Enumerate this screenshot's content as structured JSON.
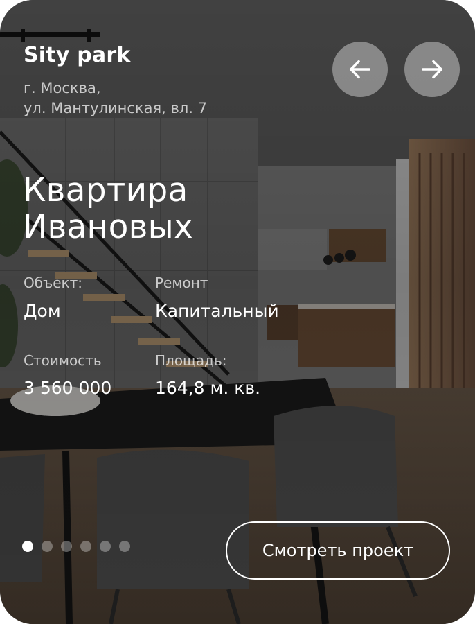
{
  "project": {
    "brand": "Sity park",
    "address_line1": "г. Москва,",
    "address_line2": "ул. Мантулинская, вл. 7",
    "title_line1": "Квартира",
    "title_line2": "Ивановых"
  },
  "details": {
    "object_label": "Объект:",
    "object_value": "Дом",
    "repair_label": "Ремонт",
    "repair_value": "Капитальный",
    "cost_label": "Стоимость",
    "cost_value": "3 560 000",
    "area_label": "Площадь:",
    "area_value": "164,8 м. кв."
  },
  "navigation": {
    "prev_icon": "arrow-left-icon",
    "next_icon": "arrow-right-icon"
  },
  "slider": {
    "total_slides": 6,
    "active_slide": 1
  },
  "cta": {
    "label": "Смотреть проект"
  }
}
